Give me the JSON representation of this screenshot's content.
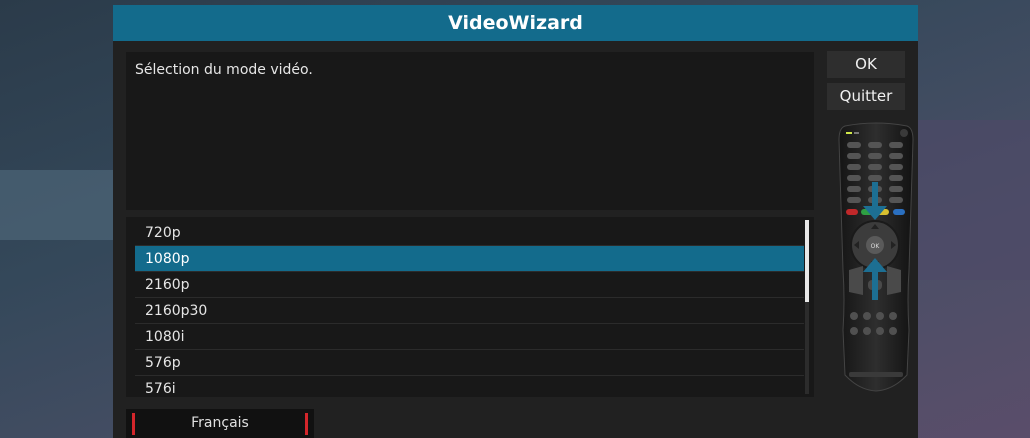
{
  "dialog": {
    "title": "VideoWizard",
    "description": "Sélection du mode vidéo."
  },
  "buttons": {
    "ok_label": "OK",
    "quit_label": "Quitter"
  },
  "modes": {
    "items": [
      "720p",
      "1080p",
      "2160p",
      "2160p30",
      "1080i",
      "576p",
      "576i"
    ],
    "selected": "1080p"
  },
  "language": {
    "label": "Français"
  },
  "colors": {
    "accent": "#136b8c",
    "language_marker": "#d4262b"
  },
  "icons": [
    "remote-control-icon",
    "arrow-down-icon",
    "arrow-up-icon"
  ]
}
